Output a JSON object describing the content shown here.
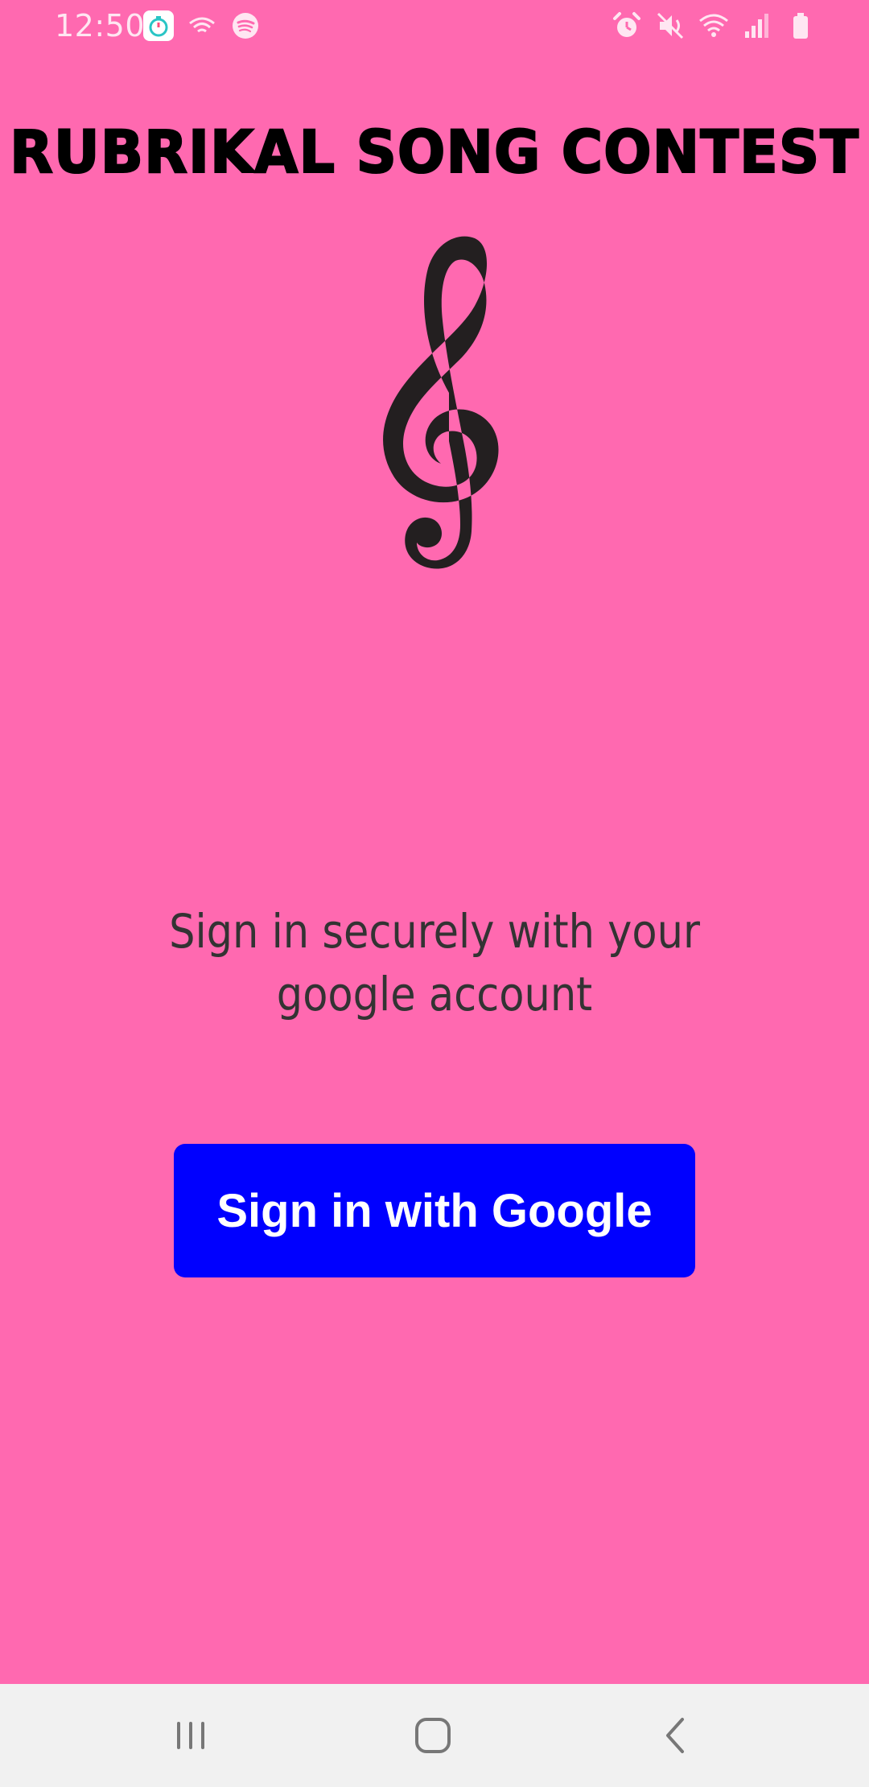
{
  "status_bar": {
    "time": "12:50",
    "left_icons": [
      "stopwatch-app-icon",
      "airplay-icon",
      "spotify-icon"
    ],
    "right_icons": [
      "alarm-icon",
      "mute-icon",
      "wifi-icon",
      "signal-icon",
      "battery-icon"
    ]
  },
  "app": {
    "title": "RUBRIKAL SONG CONTEST",
    "logo_icon": "treble-clef-icon"
  },
  "signin": {
    "instruction": "Sign in securely with your google account",
    "button_label": "Sign in with Google"
  },
  "nav_bar": {
    "buttons": [
      "recents-icon",
      "home-icon",
      "back-icon"
    ]
  },
  "colors": {
    "background": "#ff69b0",
    "button": "#0000ff",
    "button_text": "#ffffff",
    "nav_bar": "#f1f1f1"
  }
}
